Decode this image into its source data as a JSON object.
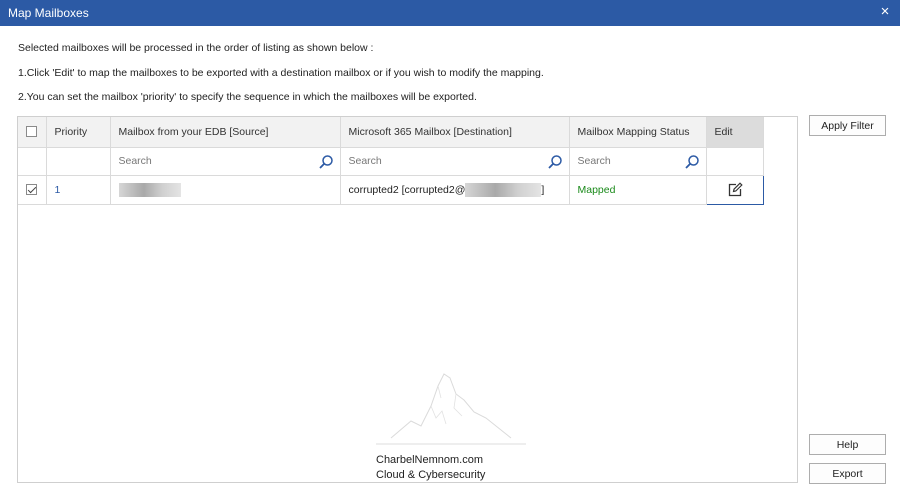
{
  "window": {
    "title": "Map Mailboxes",
    "close_glyph": "×"
  },
  "instructions": [
    "Selected mailboxes will be processed in the order of listing as shown below :",
    "1.Click 'Edit' to map the mailboxes to be exported with a destination mailbox or if you wish to modify the mapping.",
    "2.You can set the mailbox 'priority' to specify the sequence in which the mailboxes will be exported."
  ],
  "table": {
    "columns": {
      "priority": "Priority",
      "source": "Mailbox from your EDB [Source]",
      "destination": "Microsoft 365 Mailbox [Destination]",
      "status": "Mailbox Mapping Status",
      "edit": "Edit"
    },
    "search_placeholder": "Search",
    "rows": [
      {
        "checked": true,
        "priority": "1",
        "source": "",
        "destination_prefix": "corrupted2 [corrupted2@",
        "destination_suffix": "]",
        "status": "Mapped",
        "status_color": "#1a8a1a"
      }
    ]
  },
  "buttons": {
    "apply_filter": "Apply Filter",
    "help": "Help",
    "export": "Export"
  },
  "watermark": {
    "line1": "CharbelNemnom.com",
    "line2": "Cloud & Cybersecurity"
  },
  "colors": {
    "titlebar": "#2c5aa5",
    "accent": "#2c5aa5",
    "mapped": "#1a8a1a"
  },
  "icons": {
    "search": "search-icon",
    "edit": "edit-icon",
    "close": "close-icon"
  }
}
